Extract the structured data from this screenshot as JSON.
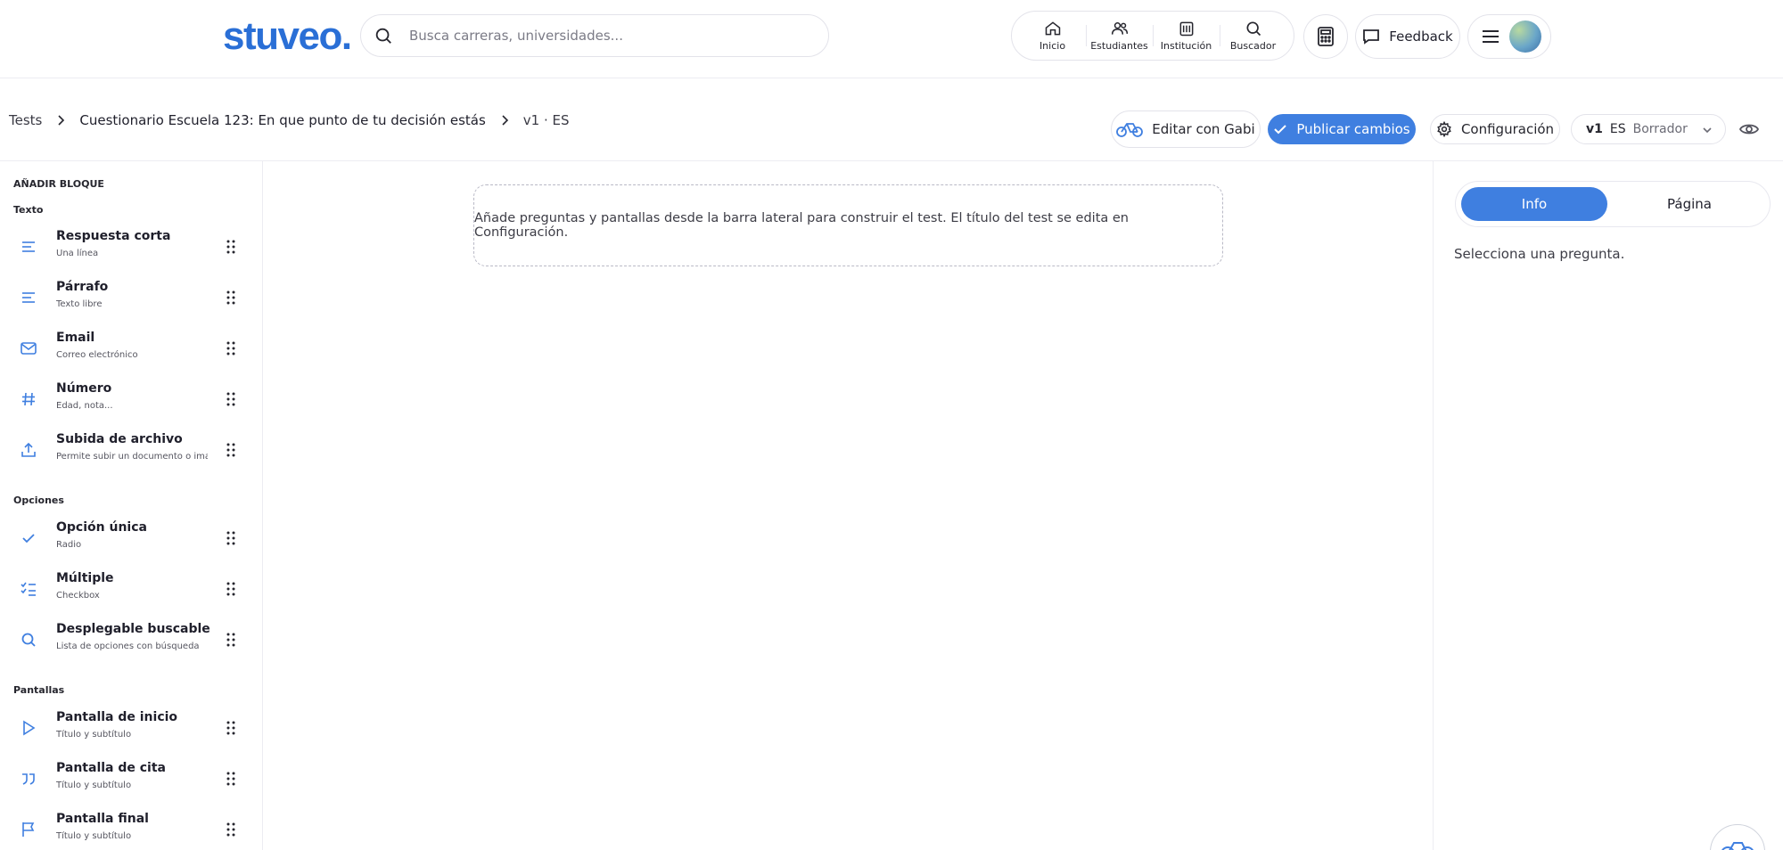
{
  "brand": {
    "logo": "stuveo."
  },
  "search": {
    "placeholder": "Busca carreras, universidades..."
  },
  "nav": [
    {
      "label": "Inicio",
      "icon": "home-icon"
    },
    {
      "label": "Estudiantes",
      "icon": "users-icon"
    },
    {
      "label": "Institución",
      "icon": "building-icon"
    },
    {
      "label": "Buscador",
      "icon": "search-icon"
    }
  ],
  "header": {
    "feedback_label": "Feedback"
  },
  "breadcrumb": {
    "root": "Tests",
    "title": "Cuestionario Escuela 123: En que punto de tu decisión estás",
    "version": "v1 · ES"
  },
  "toolbar": {
    "gabi_label": "Editar con Gabi",
    "publish_label": "Publicar cambios",
    "config_label": "Configuración",
    "version_v": "v1",
    "version_lang": "ES",
    "version_status": "Borrador"
  },
  "sidebar": {
    "heading": "AÑADIR BLOQUE",
    "sections": {
      "texto": "Texto",
      "opciones": "Opciones",
      "pantallas": "Pantallas"
    },
    "blocks": [
      {
        "title": "Respuesta corta",
        "subtitle": "Una línea",
        "icon": "text-lines-icon"
      },
      {
        "title": "Párrafo",
        "subtitle": "Texto libre",
        "icon": "paragraph-icon"
      },
      {
        "title": "Email",
        "subtitle": "Correo electrónico",
        "icon": "mail-icon"
      },
      {
        "title": "Número",
        "subtitle": "Edad, nota...",
        "icon": "hash-icon"
      },
      {
        "title": "Subida de archivo",
        "subtitle": "Permite subir un documento o imagen",
        "icon": "upload-icon"
      },
      {
        "title": "Opción única",
        "subtitle": "Radio",
        "icon": "check-icon"
      },
      {
        "title": "Múltiple",
        "subtitle": "Checkbox",
        "icon": "checklist-icon"
      },
      {
        "title": "Desplegable buscable",
        "subtitle": "Lista de opciones con búsqueda",
        "icon": "search-icon"
      },
      {
        "title": "Pantalla de inicio",
        "subtitle": "Título y subtítulo",
        "icon": "play-icon"
      },
      {
        "title": "Pantalla de cita",
        "subtitle": "Título y subtítulo",
        "icon": "quote-icon"
      },
      {
        "title": "Pantalla final",
        "subtitle": "Título y subtítulo",
        "icon": "flag-icon"
      }
    ]
  },
  "canvas": {
    "hint": "Añade preguntas y pantallas desde la barra lateral para construir el test. El título del test se edita en Configuración."
  },
  "panel": {
    "tabs": [
      "Info",
      "Página"
    ],
    "active_tab": "Info",
    "hint": "Selecciona una pregunta."
  },
  "colors": {
    "accent": "#3f7fe0",
    "brand": "#2a6fd6"
  }
}
